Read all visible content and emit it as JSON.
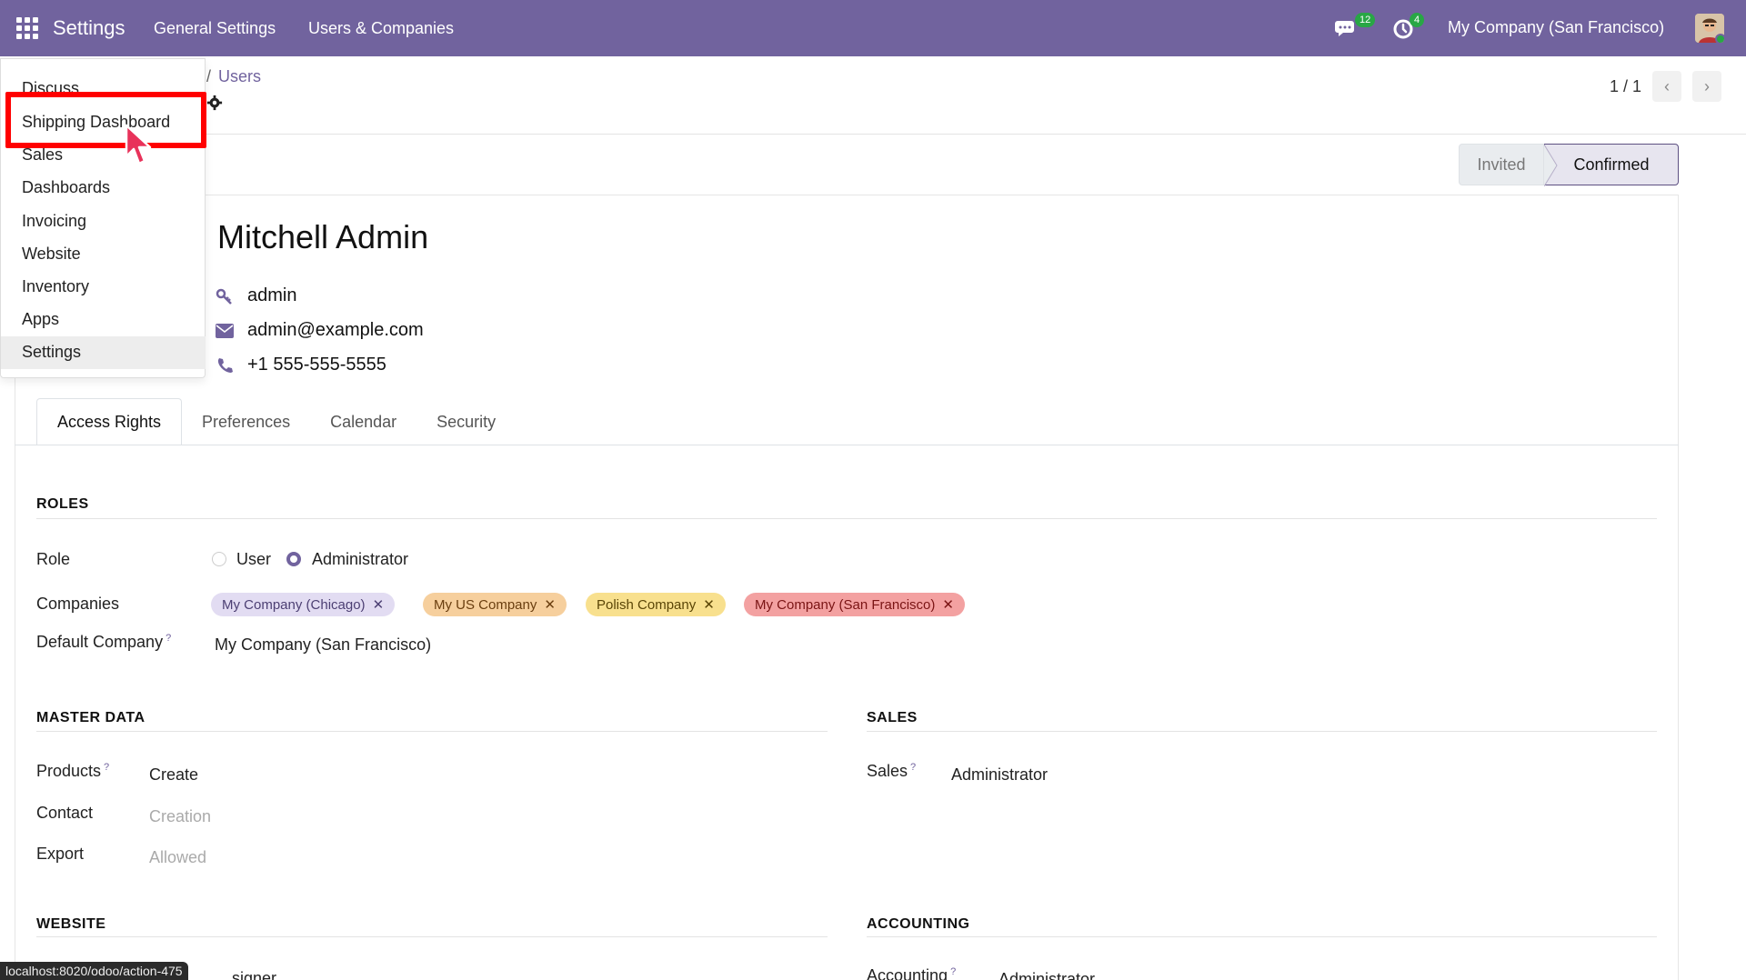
{
  "navbar": {
    "brand": "Settings",
    "menu": [
      "General Settings",
      "Users & Companies"
    ],
    "messages_count": "12",
    "activities_count": "4",
    "company": "My Company (San Francisco)"
  },
  "control_panel": {
    "breadcrumb_sep": "/",
    "breadcrumb": "Users",
    "pager": "1 / 1"
  },
  "status": {
    "invited": "Invited",
    "confirmed": "Confirmed"
  },
  "user": {
    "name": "Mitchell Admin",
    "login": "admin",
    "email": "admin@example.com",
    "phone": "+1 555-555-5555"
  },
  "tabs": [
    "Access Rights",
    "Preferences",
    "Calendar",
    "Security"
  ],
  "roles": {
    "section": "ROLES",
    "role_label": "Role",
    "role_options": [
      "User",
      "Administrator"
    ],
    "companies_label": "Companies",
    "companies": [
      {
        "name": "My Company (Chicago)",
        "bg": "#e2dcf2",
        "fg": "#4c3f73"
      },
      {
        "name": "My US Company",
        "bg": "#f6cf9d",
        "fg": "#6a3e0f"
      },
      {
        "name": "Polish Company",
        "bg": "#f8e08e",
        "fg": "#5a4506"
      },
      {
        "name": "My Company (San Francisco)",
        "bg": "#f3a1a1",
        "fg": "#7a1414"
      }
    ],
    "default_company_label": "Default Company",
    "default_company": "My Company (San Francisco)"
  },
  "master_data": {
    "section": "MASTER DATA",
    "products_label": "Products",
    "products": "Create",
    "contact_label": "Contact",
    "contact": "Creation",
    "export_label": "Export",
    "export": "Allowed"
  },
  "sales": {
    "section": "SALES",
    "sales_label": "Sales",
    "sales": "Administrator"
  },
  "website": {
    "section": "WEBSITE",
    "partial": "signer"
  },
  "accounting": {
    "section": "ACCOUNTING",
    "label": "Accounting",
    "value": "Administrator"
  },
  "dropdown": {
    "items": [
      "Discuss",
      "Shipping Dashboard",
      "Sales",
      "Dashboards",
      "Invoicing",
      "Website",
      "Inventory",
      "Apps",
      "Settings"
    ]
  },
  "status_url": "localhost:8020/odoo/action-475",
  "colors": {
    "brand": "#71639e",
    "highlight": "#ff0000"
  }
}
